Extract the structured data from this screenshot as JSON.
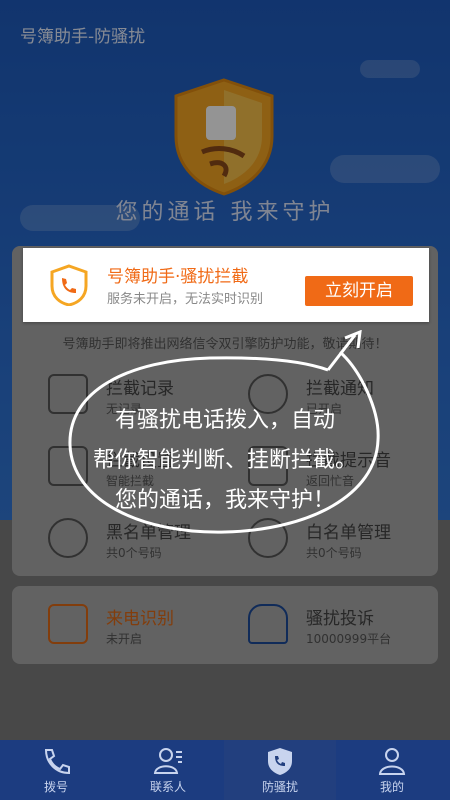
{
  "app": {
    "title": "号簿助手-防骚扰",
    "tagline": "您的通话  我来守护"
  },
  "banner": {
    "title": "号簿助手·骚扰拦截",
    "subtitle": "服务未开启，无法实时识别",
    "button": "立刻开启",
    "accent": "#f06a16"
  },
  "notice": "号簿助手即将推出网络信令双引擎防护功能，敬请期待！",
  "features": [
    {
      "title": "拦截记录",
      "sub": "无记录"
    },
    {
      "title": "拦截通知",
      "sub": "已开启"
    },
    {
      "title": "拦截设置",
      "sub": "智能拦截"
    },
    {
      "title": "拦截提示音",
      "sub": "返回忙音"
    },
    {
      "title": "黑名单管理",
      "sub": "共0个号码"
    },
    {
      "title": "白名单管理",
      "sub": "共0个号码"
    }
  ],
  "bottom_cards": [
    {
      "title": "来电识别",
      "sub": "未开启"
    },
    {
      "title": "骚扰投诉",
      "sub": "10000999平台"
    }
  ],
  "bubble": {
    "line1": "有骚扰电话拨入，自动",
    "line2": "帮你智能判断、挂断拦截。",
    "line3": "您的通话，我来守护！"
  },
  "tabs": [
    {
      "label": "拨号",
      "icon": "phone-icon"
    },
    {
      "label": "联系人",
      "icon": "contacts-icon"
    },
    {
      "label": "防骚扰",
      "icon": "shield-phone-icon",
      "active": true
    },
    {
      "label": "我的",
      "icon": "person-icon"
    }
  ]
}
